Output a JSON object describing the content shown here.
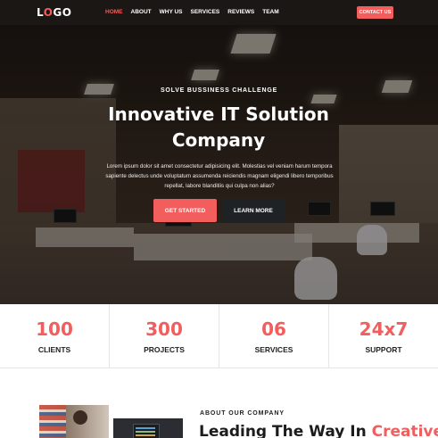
{
  "nav": {
    "logo_prefix": "L",
    "logo_o": "O",
    "logo_suffix": "GO",
    "items": [
      {
        "label": "HOME",
        "active": true
      },
      {
        "label": "ABOUT",
        "active": false
      },
      {
        "label": "WHY US",
        "active": false
      },
      {
        "label": "SERVICES",
        "active": false
      },
      {
        "label": "REVIEWS",
        "active": false
      },
      {
        "label": "TEAM",
        "active": false
      }
    ],
    "contact_label": "CONTACT US"
  },
  "hero": {
    "eyebrow": "SOLVE BUSSINESS CHALLENGE",
    "title": "Innovative IT Solution Company",
    "description": "Lorem ipsum dolor sit amet consectetur adipisicing elit. Molestias vel veniam harum tempora sapiente delectus unde voluptatum assumenda reiciendis magnam eligendi libero temporibus repellat, labore blanditiis qui culpa non alias?",
    "primary_button": "GET STARTED",
    "secondary_button": "LEARN MORE"
  },
  "stats": [
    {
      "value": "100",
      "label": "CLIENTS"
    },
    {
      "value": "300",
      "label": "PROJECTS"
    },
    {
      "value": "06",
      "label": "SERVICES"
    },
    {
      "value": "24x7",
      "label": "SUPPORT"
    }
  ],
  "about": {
    "eyebrow": "ABOUT OUR COMPANY",
    "title_plain": "Leading The Way In ",
    "title_accent": "Creative"
  },
  "colors": {
    "accent": "#f25d5d",
    "dark_button": "#1f2225",
    "nav_bg": "#1c1816"
  }
}
